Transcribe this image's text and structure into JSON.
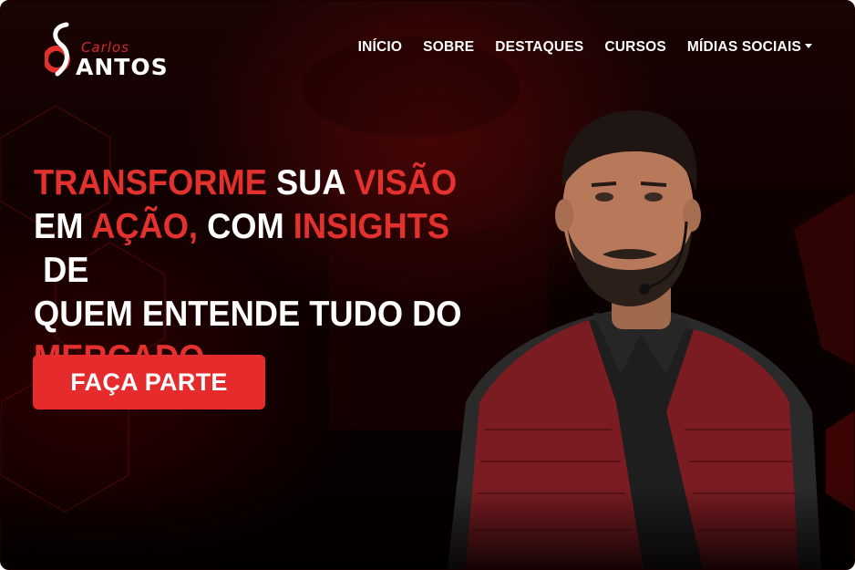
{
  "brand": {
    "logo_top": "Carlos",
    "logo_bottom": "ANTOS"
  },
  "nav": {
    "items": [
      {
        "label": "INÍCIO"
      },
      {
        "label": "SOBRE"
      },
      {
        "label": "DESTAQUES"
      },
      {
        "label": "CURSOS"
      },
      {
        "label": "MÍDIAS SOCIAIS"
      }
    ]
  },
  "hero": {
    "line1": [
      {
        "text": "TRANSFORME",
        "accent": true
      },
      {
        "text": " SUA ",
        "accent": false
      },
      {
        "text": "VISÃO",
        "accent": true
      }
    ],
    "line2": [
      {
        "text": "EM ",
        "accent": false
      },
      {
        "text": "AÇÃO,",
        "accent": true
      },
      {
        "text": " COM ",
        "accent": false
      },
      {
        "text": "INSIGHTS",
        "accent": true
      },
      {
        "text": " DE",
        "accent": false
      }
    ],
    "line3": [
      {
        "text": "QUEM ENTENDE TUDO DO",
        "accent": false
      }
    ],
    "line4": [
      {
        "text": "MERCADO.",
        "accent": true
      }
    ],
    "cta_label": "FAÇA PARTE"
  },
  "colors": {
    "accent": "#e3312d",
    "background": "#0a0000",
    "text": "#ffffff"
  }
}
